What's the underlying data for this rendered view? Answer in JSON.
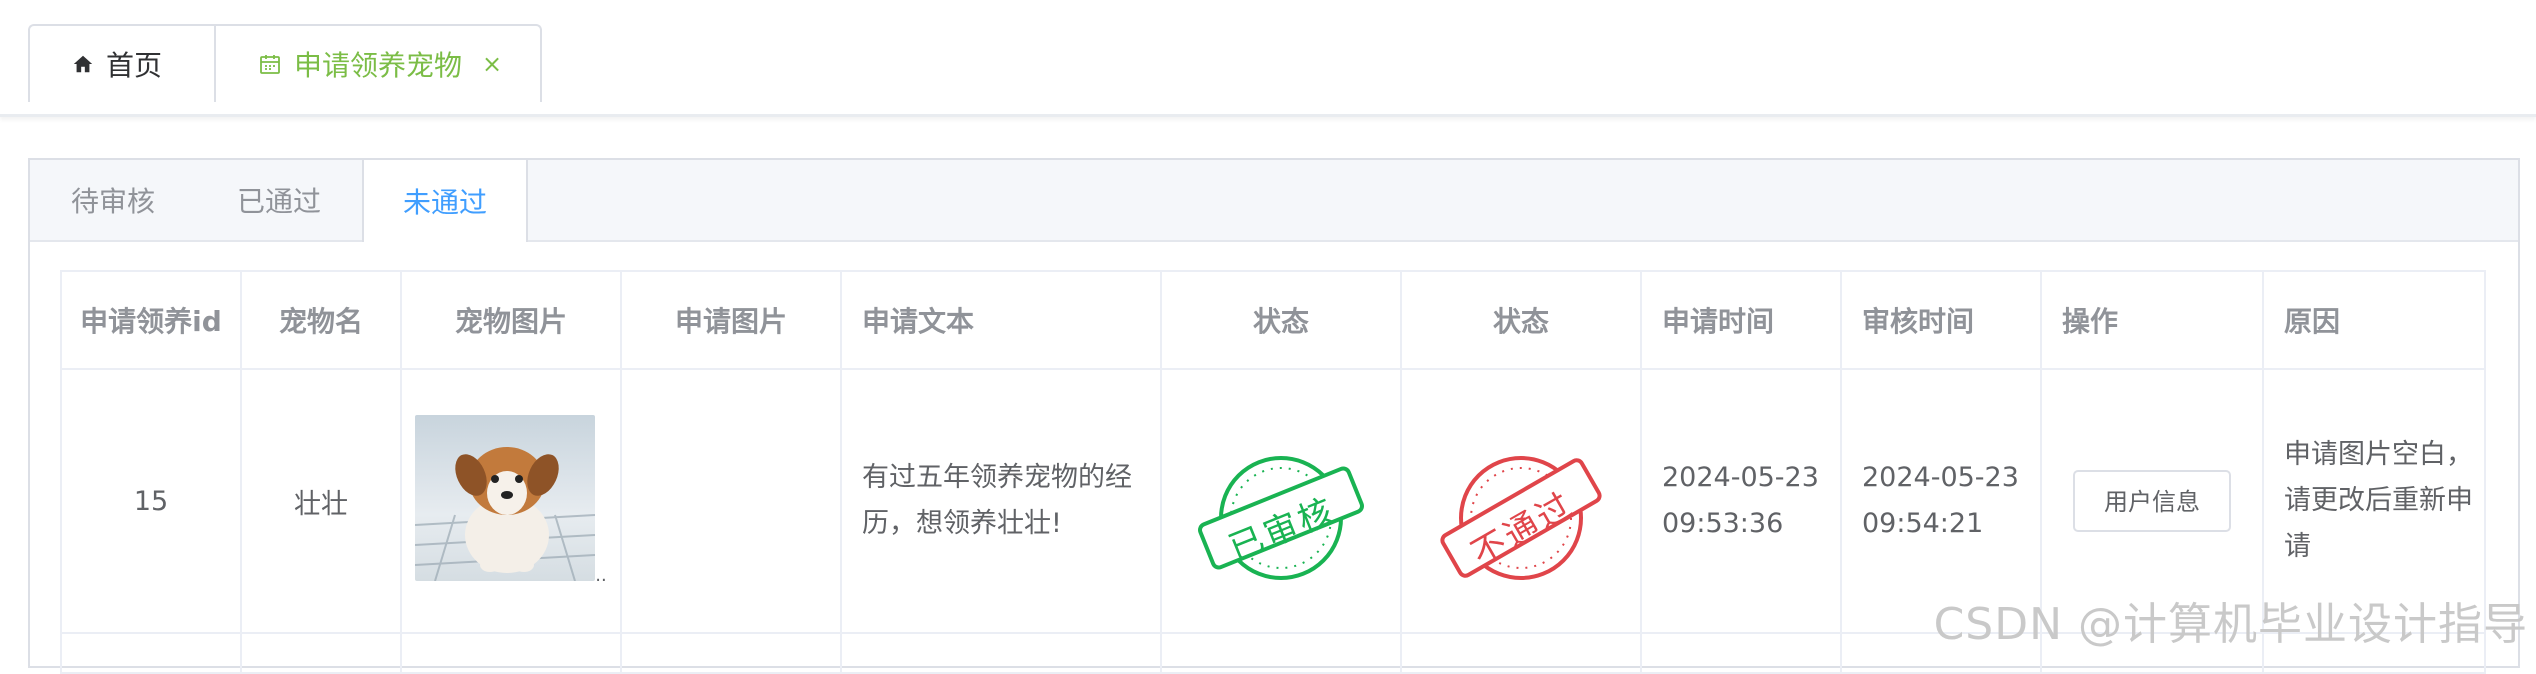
{
  "tags": {
    "home": "首页",
    "active": "申请领养宠物",
    "close": "×"
  },
  "tabs": [
    "待审核",
    "已通过",
    "未通过"
  ],
  "active_tab_index": 2,
  "table": {
    "headers": [
      "申请领养id",
      "宠物名",
      "宠物图片",
      "申请图片",
      "申请文本",
      "状态",
      "状态",
      "申请时间",
      "审核时间",
      "操作",
      "原因"
    ],
    "rows": [
      {
        "id": "15",
        "pet_name": "壮壮",
        "pet_image_dots": "..",
        "apply_image": "",
        "apply_text": "有过五年领养宠物的经历，想领养壮壮!",
        "status1_stamp": "已审核",
        "status2_stamp": "不通过",
        "apply_time": "2024-05-23 09:53:36",
        "review_time": "2024-05-23 09:54:21",
        "action_label": "用户信息",
        "reason": "申请图片空白，请更改后重新申请"
      }
    ]
  },
  "watermark": "CSDN @计算机毕业设计指导",
  "colors": {
    "accent_green": "#7bbd46",
    "tab_active_blue": "#409eff",
    "stamp_green": "#19b352",
    "stamp_red": "#e0454a"
  }
}
